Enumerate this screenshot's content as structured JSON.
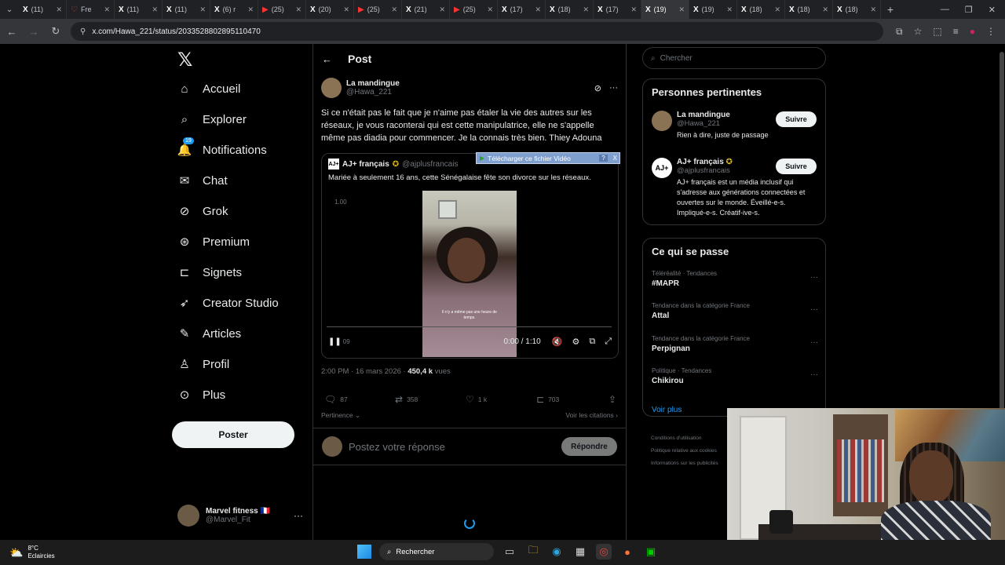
{
  "browser": {
    "tabs": [
      {
        "icon": "X",
        "label": "(11)",
        "active": false
      },
      {
        "icon": "♡",
        "label": "Fre",
        "active": false,
        "red": true
      },
      {
        "icon": "X",
        "label": "(11)",
        "active": false
      },
      {
        "icon": "X",
        "label": "(11)",
        "active": false
      },
      {
        "icon": "X",
        "label": "(6) r",
        "active": false
      },
      {
        "icon": "▶",
        "label": "(25)",
        "active": false,
        "yt": true
      },
      {
        "icon": "X",
        "label": "(20)",
        "active": false
      },
      {
        "icon": "▶",
        "label": "(25)",
        "active": false,
        "yt": true
      },
      {
        "icon": "X",
        "label": "(21)",
        "active": false
      },
      {
        "icon": "▶",
        "label": "(25)",
        "active": false,
        "yt": true
      },
      {
        "icon": "X",
        "label": "(17)",
        "active": false
      },
      {
        "icon": "X",
        "label": "(18)",
        "active": false
      },
      {
        "icon": "X",
        "label": "(17)",
        "active": false
      },
      {
        "icon": "X",
        "label": "(19)",
        "active": true
      },
      {
        "icon": "X",
        "label": "(19)",
        "active": false
      },
      {
        "icon": "X",
        "label": "(18)",
        "active": false
      },
      {
        "icon": "X",
        "label": "(18)",
        "active": false
      },
      {
        "icon": "X",
        "label": "(18)",
        "active": false
      }
    ],
    "url": "x.com/Hawa_221/status/2033528802895110470"
  },
  "nav": {
    "items": [
      {
        "label": "Accueil",
        "icon": "home-icon",
        "glyph": "⌂"
      },
      {
        "label": "Explorer",
        "icon": "search-icon",
        "glyph": "⌕"
      },
      {
        "label": "Notifications",
        "icon": "bell-icon",
        "glyph": "🔔",
        "badge": "19"
      },
      {
        "label": "Chat",
        "icon": "mail-icon",
        "glyph": "✉"
      },
      {
        "label": "Grok",
        "icon": "grok-icon",
        "glyph": "⊘"
      },
      {
        "label": "Premium",
        "icon": "premium-icon",
        "glyph": "⊛"
      },
      {
        "label": "Signets",
        "icon": "bookmark-icon",
        "glyph": "⊏"
      },
      {
        "label": "Creator Studio",
        "icon": "rocket-icon",
        "glyph": "➶"
      },
      {
        "label": "Articles",
        "icon": "article-icon",
        "glyph": "✎"
      },
      {
        "label": "Profil",
        "icon": "profile-icon",
        "glyph": "♙"
      },
      {
        "label": "Plus",
        "icon": "more-icon",
        "glyph": "⊙"
      }
    ],
    "post_button": "Poster",
    "account": {
      "name": "Marvel fitness 🇫🇷",
      "handle": "@Marvel_Fit"
    }
  },
  "post": {
    "header_title": "Post",
    "author": {
      "name": "La mandingue",
      "handle": "@Hawa_221"
    },
    "text": "Si ce n'était pas le fait que je n'aime pas étaler la vie des autres sur les réseaux, je vous raconterai qui est cette manipulatrice, elle ne s'appelle même pas diadia pour commencer. Je la connais très bien. Thiey Adouna",
    "quote": {
      "logo": "AJ+",
      "name": "AJ+ français",
      "handle": "@ajplusfrancais",
      "text": "Mariée à seulement 16 ans, cette Sénégalaise fête son divorce sur les réseaux.",
      "video_caption": "Il n'y a même pas une heure de temps.",
      "video_time": "0:00 / 1:10",
      "video_speed": "1.00",
      "loading_time": "09"
    },
    "download_bar": {
      "label": "Télécharger ce fichier Vidéo",
      "help": "?",
      "close": "X"
    },
    "timestamp": "2:00 PM · 16 mars 2026 · ",
    "views": "450,4 k",
    "views_label": " vues",
    "stats": {
      "replies": "87",
      "reposts": "358",
      "likes": "1 k",
      "bookmarks": "703"
    },
    "sort_label": "Pertinence",
    "quotes_link": "Voir les citations",
    "reply_placeholder": "Postez votre réponse",
    "reply_button": "Répondre"
  },
  "sidebar": {
    "search_placeholder": "Chercher",
    "people_title": "Personnes pertinentes",
    "people": [
      {
        "name": "La mandingue",
        "handle": "@Hawa_221",
        "bio": "Rien à dire, juste de passage",
        "button": "Suivre"
      },
      {
        "name": "AJ+ français",
        "handle": "@ajplusfrancais",
        "bio": "AJ+ français est un média inclusif qui s'adresse aux générations connectées et ouvertes sur le monde. Éveillé-e-s. Impliqué-e-s. Créatif-ive-s.",
        "button": "Suivre"
      }
    ],
    "trends_title": "Ce qui se passe",
    "trends": [
      {
        "category": "Téléréalité · Tendances",
        "title": "#MAPR"
      },
      {
        "category": "Tendance dans la catégorie France",
        "title": "Attal"
      },
      {
        "category": "Tendance dans la catégorie France",
        "title": "Perpignan"
      },
      {
        "category": "Politique · Tendances",
        "title": "Chikirou"
      }
    ],
    "see_more": "Voir plus",
    "footer": [
      "Conditions d'utilisation",
      "Politique relative aux cookies",
      "Informations sur les publicités"
    ]
  },
  "taskbar": {
    "weather_temp": "8°C",
    "weather_desc": "Eclaircies",
    "search_label": "Rechercher"
  }
}
